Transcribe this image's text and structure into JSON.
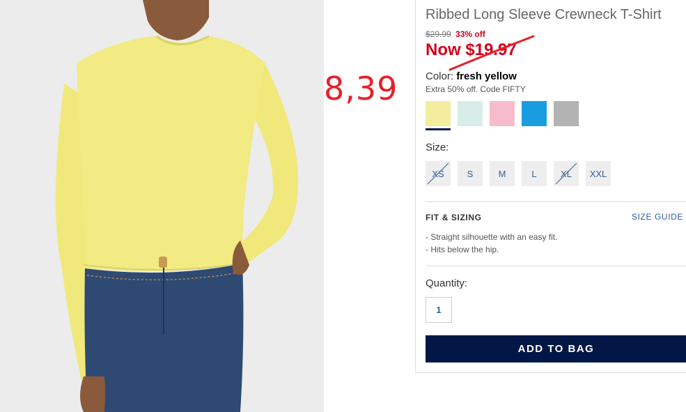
{
  "annotation": {
    "handwritten_price": "8,39"
  },
  "product": {
    "title": "Ribbed Long Sleeve Crewneck T-Shirt",
    "was_price": "$29.99",
    "discount": "33% off",
    "now_price": "Now $19.97",
    "color_label": "Color:",
    "color_name": "fresh yellow",
    "promo": "Extra 50% off. Code FIFTY"
  },
  "swatches": [
    {
      "color": "#f4eda0",
      "selected": true
    },
    {
      "color": "#d8ede7",
      "selected": false
    },
    {
      "color": "#f6bccb",
      "selected": false
    },
    {
      "color": "#1a9de0",
      "selected": false
    },
    {
      "color": "#b3b3b3",
      "selected": false
    }
  ],
  "sizes": {
    "label": "Size:",
    "options": [
      "XS",
      "S",
      "M",
      "L",
      "XL",
      "XXL"
    ],
    "unavailable": [
      "XS",
      "XL"
    ]
  },
  "fit": {
    "title": "FIT & SIZING",
    "guide_link": "SIZE GUIDE",
    "bullets": [
      "Straight silhouette with an easy fit.",
      "Hits below the hip."
    ]
  },
  "quantity": {
    "label": "Quantity:",
    "value": "1"
  },
  "cart": {
    "add_label": "ADD TO BAG"
  },
  "colors": {
    "accent": "#031746",
    "sale": "#d0021b",
    "link": "#2f5f9c",
    "annotation": "#e8202a"
  }
}
